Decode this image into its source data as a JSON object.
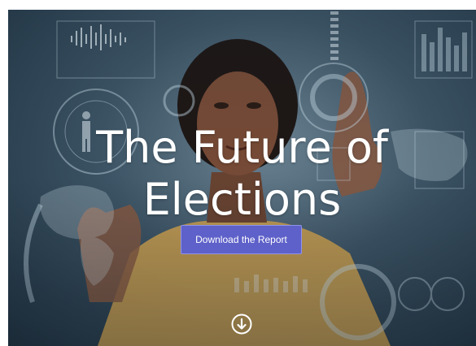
{
  "hero": {
    "title_line1": "The Future of",
    "title_line2": "Elections",
    "cta_label": "Download the Report"
  },
  "icons": {
    "scroll": "arrow-down-circle-icon"
  },
  "colors": {
    "cta_background": "#5e61c9",
    "cta_border": "#8f92ea",
    "title": "#ffffff",
    "backdrop": "#3d5566"
  }
}
